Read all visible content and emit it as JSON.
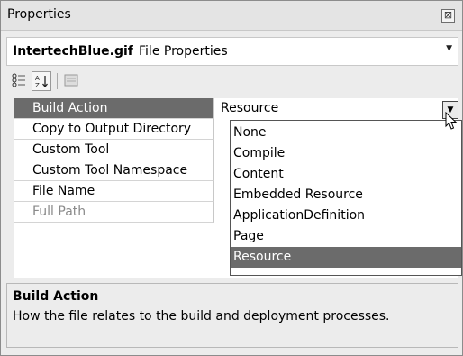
{
  "window": {
    "title": "Properties"
  },
  "object_selector": {
    "name": "IntertechBlue.gif",
    "type": "File Properties"
  },
  "properties": [
    {
      "name": "Build Action",
      "value": "Resource"
    },
    {
      "name": "Copy to Output Directory",
      "value": ""
    },
    {
      "name": "Custom Tool",
      "value": ""
    },
    {
      "name": "Custom Tool Namespace",
      "value": ""
    },
    {
      "name": "File Name",
      "value": ""
    },
    {
      "name": "Full Path",
      "value": ""
    }
  ],
  "dropdown": {
    "options": [
      "None",
      "Compile",
      "Content",
      "Embedded Resource",
      "ApplicationDefinition",
      "Page",
      "Resource"
    ],
    "selected": "Resource"
  },
  "description": {
    "title": "Build Action",
    "text": "How the file relates to the build and deployment processes."
  },
  "colors": {
    "selection": "#6b6b6b",
    "background": "#ececec"
  }
}
